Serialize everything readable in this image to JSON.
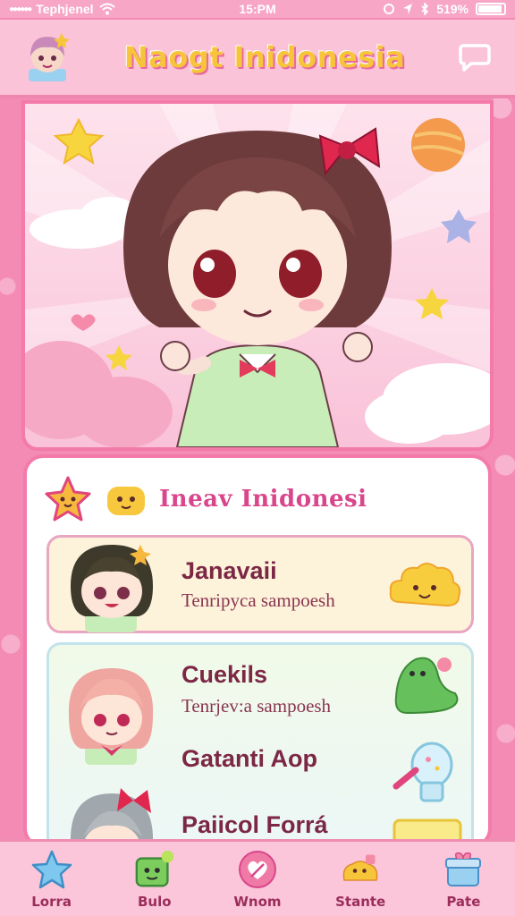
{
  "status_bar": {
    "carrier": "Tephjenel",
    "time": "15:PM",
    "battery": "519%"
  },
  "header": {
    "app_title": "Naogt Inidonesia"
  },
  "panel": {
    "title": "Ineav Inidonesi",
    "cards": [
      {
        "title": "Janavaii",
        "subtitle": "Tenripyca sampoesh"
      },
      {
        "title": "Cuekils",
        "subtitle": "Tenrjev:a sampoesh"
      }
    ],
    "list_items": [
      {
        "title": "Gatanti Aop"
      },
      {
        "title": "Paiicol Forrá"
      }
    ]
  },
  "bottom_nav": {
    "items": [
      {
        "label": "Lorra",
        "icon": "star-icon"
      },
      {
        "label": "Bulo",
        "icon": "green-monster-icon"
      },
      {
        "label": "Wnom",
        "icon": "heart-icon"
      },
      {
        "label": "Stante",
        "icon": "puppy-icon"
      },
      {
        "label": "Pate",
        "icon": "gift-box-icon"
      }
    ]
  },
  "colors": {
    "background": "#f48bb4",
    "header": "#fbc3d8",
    "accent": "#f37aa9",
    "title_yellow": "#f7c53a",
    "card_title": "#7b2745"
  }
}
